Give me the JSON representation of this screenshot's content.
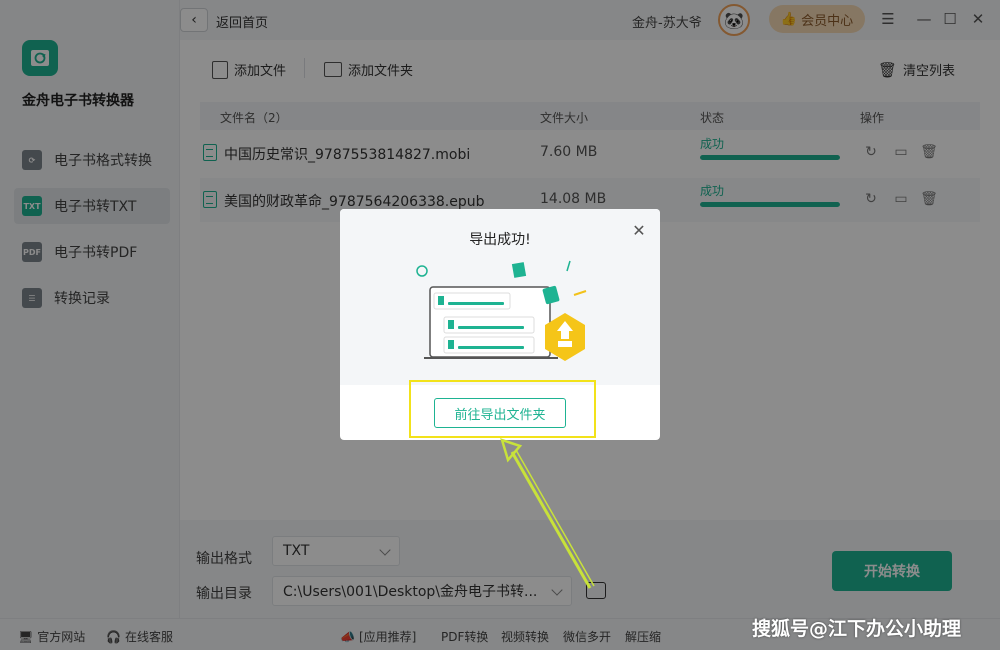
{
  "app": {
    "name": "金舟电子书转换器",
    "back_label": "返回首页",
    "username": "金舟-苏大爷",
    "vip_label": "会员中心"
  },
  "sidebar": {
    "items": [
      {
        "label": "电子书格式转换",
        "icon": "refresh-icon",
        "icon_text": "",
        "active": false
      },
      {
        "label": "电子书转TXT",
        "icon": "txt-icon",
        "icon_text": "TXT",
        "active": true
      },
      {
        "label": "电子书转PDF",
        "icon": "pdf-icon",
        "icon_text": "PDF",
        "active": false
      },
      {
        "label": "转换记录",
        "icon": "list-icon",
        "icon_text": "",
        "active": false
      }
    ]
  },
  "toolbar": {
    "add_file": "添加文件",
    "add_folder": "添加文件夹",
    "clear_list": "清空列表"
  },
  "table": {
    "headers": {
      "name": "文件名（2）",
      "size": "文件大小",
      "status": "状态",
      "actions": "操作"
    },
    "rows": [
      {
        "name": "中国历史常识_9787553814827.mobi",
        "size": "7.60 MB",
        "status": "成功",
        "progress": 1.0
      },
      {
        "name": "美国的财政革命_9787564206338.epub",
        "size": "14.08 MB",
        "status": "成功",
        "progress": 1.0
      }
    ]
  },
  "settings": {
    "format_label": "输出格式",
    "format_value": "TXT",
    "dir_label": "输出目录",
    "dir_value": "C:\\Users\\001\\Desktop\\金舟电子书转...",
    "start_label": "开始转换"
  },
  "footer": {
    "website": "官方网站",
    "service": "在线客服",
    "recommend": "[应用推荐]",
    "links": [
      "PDF转换",
      "视频转换",
      "微信多开",
      "解压缩"
    ]
  },
  "modal": {
    "title": "导出成功!",
    "button": "前往导出文件夹"
  },
  "watermark": "搜狐号@江下办公小助理",
  "colors": {
    "accent": "#1eb392",
    "vip_bg": "#f5d9b4",
    "highlight": "#f2e21a",
    "arrow": "#c8e23a"
  }
}
